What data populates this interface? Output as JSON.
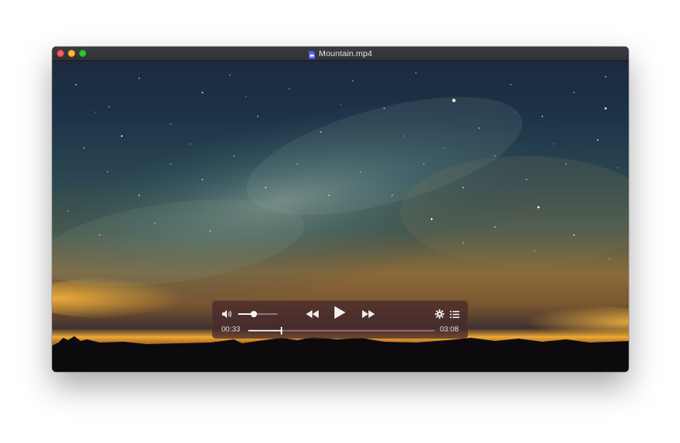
{
  "window": {
    "title": "Mountain.mp4",
    "file_icon": "video-file-icon"
  },
  "traffic_lights": {
    "close": "#fd5f57",
    "minimize": "#febc2e",
    "zoom": "#28c840"
  },
  "player": {
    "volume_icon": "speaker-volume-icon",
    "volume_level": 0.4,
    "rewind_icon": "rewind-icon",
    "play_icon": "play-icon",
    "fast_forward_icon": "fast-forward-icon",
    "settings_icon": "gear-icon",
    "playlist_icon": "list-icon",
    "elapsed": "00:33",
    "duration": "03:08",
    "progress": 0.18
  },
  "video": {
    "description_icon": "night-sky-milky-way-frame"
  }
}
